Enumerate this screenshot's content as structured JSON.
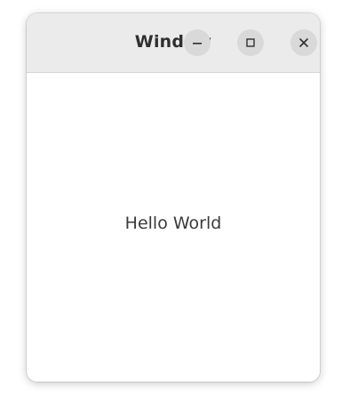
{
  "window": {
    "title": "Window",
    "controls": {
      "minimize_icon": "minimize-icon",
      "maximize_icon": "maximize-icon",
      "close_icon": "close-icon"
    }
  },
  "content": {
    "label": "Hello World"
  },
  "colors": {
    "titlebar": "#ebebeb",
    "control_bg": "#d9d9d9",
    "text": "#2f2f2f"
  }
}
